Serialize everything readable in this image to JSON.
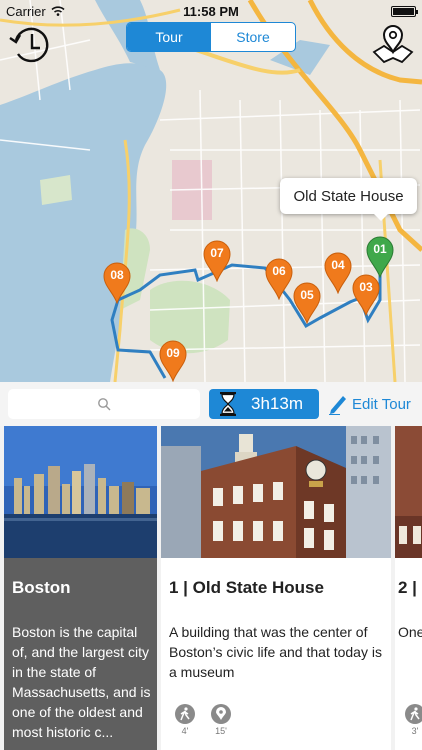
{
  "status_bar": {
    "carrier": "Carrier",
    "time": "11:58 PM",
    "battery_level": 1.0
  },
  "header": {
    "tabs": [
      {
        "label": "Tour",
        "active": true
      },
      {
        "label": "Store",
        "active": false
      }
    ],
    "clock_icon": "clock-rewind-icon",
    "pins_icon": "map-pins-icon"
  },
  "map": {
    "callout": "Old State House",
    "pins": [
      {
        "label": "01",
        "color": "#3fa84a"
      },
      {
        "label": "03",
        "color": "#f07a1c"
      },
      {
        "label": "04",
        "color": "#f07a1c"
      },
      {
        "label": "05",
        "color": "#f07a1c"
      },
      {
        "label": "06",
        "color": "#f07a1c"
      },
      {
        "label": "07",
        "color": "#f07a1c"
      },
      {
        "label": "08",
        "color": "#f07a1c"
      },
      {
        "label": "09",
        "color": "#f07a1c"
      }
    ],
    "route_color": "#2f7fc1"
  },
  "toolbar": {
    "search_placeholder": "",
    "duration": "3h13m",
    "edit_label": "Edit Tour"
  },
  "cards": {
    "city": {
      "title": "Boston",
      "description": "Boston is the capital of, and the largest city in the state of Massachusetts, and is one of the oldest and most historic c..."
    },
    "stop1": {
      "title": "1 | Old State House",
      "description": "A building that was the center of Boston’s civic life and that today is a museum",
      "walk_time": "4'",
      "visit_time": "15'"
    },
    "stop2": {
      "title": "2 |",
      "description": "One Bos",
      "walk_time": "3'"
    }
  },
  "colors": {
    "accent": "#1e88d6",
    "pin_orange": "#f07a1c",
    "pin_green": "#3fa84a"
  }
}
